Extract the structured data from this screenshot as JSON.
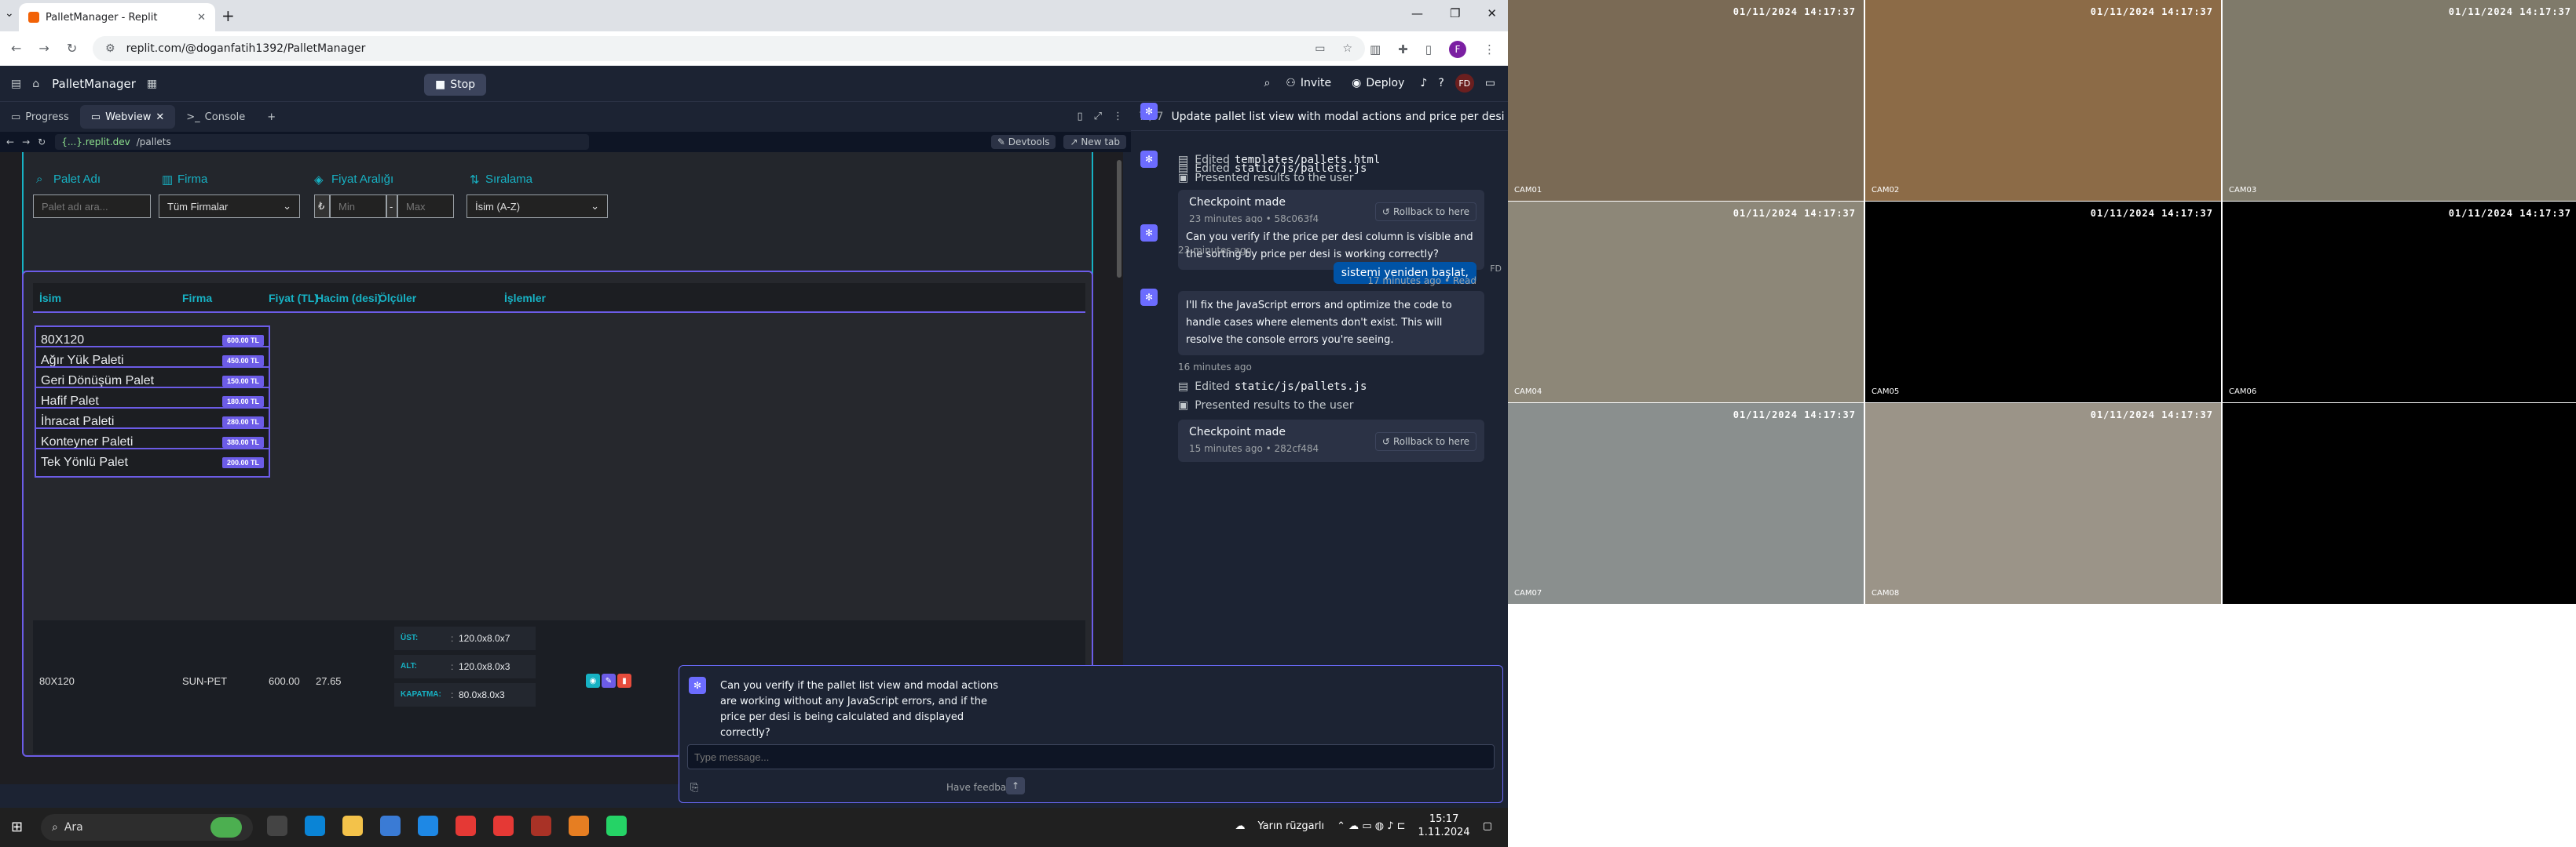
{
  "browser": {
    "tab_title": "PalletManager - Replit",
    "address": "replit.com/@doganfatih1392/PalletManager",
    "profile_initial": "F"
  },
  "replit": {
    "project_name": "PalletManager",
    "stop_label": "Stop",
    "invite_label": "Invite",
    "deploy_label": "Deploy",
    "user_initials": "FD",
    "tabs": [
      "Progress",
      "Webview",
      "Console"
    ],
    "webview_host": "{...}.replit.dev",
    "webview_path": "/pallets",
    "devtools_label": "Devtools",
    "newtab_label": "New tab"
  },
  "app": {
    "filters": {
      "name_label": "Palet Adı",
      "name_placeholder": "Palet adı ara...",
      "company_label": "Firma",
      "company_value": "Tüm Firmalar",
      "price_label": "Fiyat Aralığı",
      "currency": "₺",
      "min_placeholder": "Min",
      "max_placeholder": "Max",
      "sort_label": "Sıralama",
      "sort_value": "İsim (A-Z)"
    },
    "columns": [
      "İsim",
      "Firma",
      "Fiyat (TL)",
      "Hacim (desi)",
      "Ölçüler",
      "İşlemler"
    ],
    "list_items": [
      {
        "name": "80X120",
        "price": "600.00 TL"
      },
      {
        "name": "Ağır Yük Paleti",
        "price": "450.00 TL"
      },
      {
        "name": "Geri Dönüşüm Palet",
        "price": "150.00 TL"
      },
      {
        "name": "Hafif Palet",
        "price": "180.00 TL"
      },
      {
        "name": "İhracat Paleti",
        "price": "280.00 TL"
      },
      {
        "name": "Konteyner Paleti",
        "price": "380.00 TL"
      },
      {
        "name": "Tek Yönlü Palet",
        "price": "200.00 TL"
      }
    ],
    "detail_row": {
      "name": "80X120",
      "company": "SUN-PET",
      "price": "600.00",
      "volume": "27.65",
      "dims": [
        {
          "key": "ÜST:",
          "value": "120.0x8.0x7"
        },
        {
          "key": "ALT:",
          "value": "120.0x8.0x3"
        },
        {
          "key": "KAPATMA:",
          "value": "80.0x8.0x3"
        }
      ]
    }
  },
  "agent": {
    "progress": "7 / 7",
    "header": "Update pallet list view with modal actions and price per desi",
    "edited_label": "Edited",
    "presented_label": "Presented results to the user",
    "file_pallets_html": "templates/pallets.html",
    "file_pallets_js": "static/js/pallets.js",
    "checkpoint_label": "Checkpoint made",
    "rollback_label": "Rollback to here",
    "checkpoint1_meta": "23 minutes ago • 58c063f4",
    "checkpoint2_meta": "15 minutes ago • 282cf484",
    "msg1": "Can you verify if the price per desi column is visible and the sorting by price per desi is working correctly?",
    "msg1_time": "23 minutes ago",
    "user_msg": "sistemi yeniden başlat,",
    "user_msg_time": "17 minutes ago • Read",
    "msg2": "I'll fix the JavaScript errors and optimize the code to handle cases where elements don't exist. This will resolve the console errors you're seeing.",
    "msg2_time": "16 minutes ago",
    "msg3": "Can you verify if the pallet list view and modal actions are working without any JavaScript errors, and if the price per desi is being calculated and displayed correctly?",
    "compose_placeholder": "Type message...",
    "feedback_label": "Have feedback?"
  },
  "taskbar": {
    "search_text": "Ara",
    "weather": "Yarın rüzgarlı",
    "time": "15:17",
    "date": "1.11.2024"
  },
  "cameras": [
    {
      "label": "CAM01",
      "timestamp": "01/11/2024 14:17:37",
      "color": "#7a6a55"
    },
    {
      "label": "CAM02",
      "timestamp": "01/11/2024 14:17:37",
      "color": "#8c6b47"
    },
    {
      "label": "CAM03",
      "timestamp": "01/11/2024 14:17:37",
      "color": "#7f7a6a"
    },
    {
      "label": "CAM04",
      "timestamp": "01/11/2024 14:17:37",
      "color": "#8d8778"
    },
    {
      "label": "CAM05",
      "timestamp": "01/11/2024 14:17:37",
      "color": "#000000"
    },
    {
      "label": "CAM06",
      "timestamp": "01/11/2024 14:17:37",
      "color": "#000000"
    },
    {
      "label": "CAM07",
      "timestamp": "01/11/2024 14:17:37",
      "color": "#8a8f8e"
    },
    {
      "label": "CAM08",
      "timestamp": "01/11/2024 14:17:37",
      "color": "#9b9488"
    },
    {
      "label": "",
      "timestamp": "",
      "color": "#000000"
    }
  ]
}
